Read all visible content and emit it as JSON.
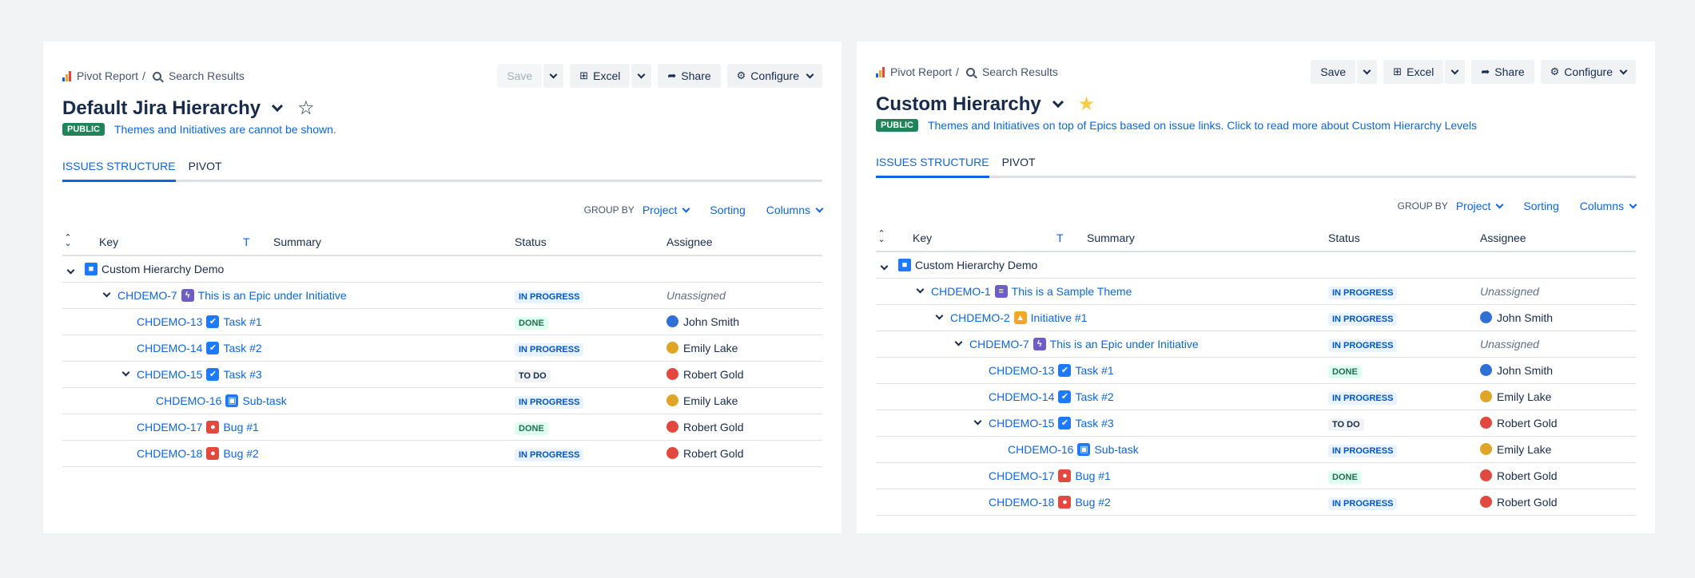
{
  "colors": {
    "accent": "#0c66e4",
    "public": "#1f845a",
    "inprogress": "#0055cc",
    "done": "#216e4e"
  },
  "panels": [
    {
      "breadcrumb": {
        "root": "Pivot Report",
        "separator": "/",
        "current": "Search Results"
      },
      "toolbar": {
        "save": "Save",
        "excel": "Excel",
        "share": "Share",
        "configure": "Configure",
        "save_disabled": true
      },
      "title": "Default Jira Hierarchy",
      "starred": false,
      "lozenge": "PUBLIC",
      "note": "Themes and Initiatives are cannot be shown.",
      "tabs": [
        "ISSUES STRUCTURE",
        "PIVOT"
      ],
      "controls": {
        "group_by_label": "GROUP BY",
        "group_by_value": "Project",
        "sorting": "Sorting",
        "columns": "Columns"
      },
      "headers": {
        "key": "Key",
        "type": "T",
        "summary": "Summary",
        "status": "Status",
        "assignee": "Assignee"
      },
      "rows": [
        {
          "level": 0,
          "expanded": true,
          "type": "project",
          "key": "",
          "summary": "Custom Hierarchy Demo",
          "status": "",
          "status_kind": "",
          "assignee": "",
          "avatar": ""
        },
        {
          "level": 1,
          "expanded": true,
          "type": "epic",
          "key": "CHDEMO-7",
          "summary": "This is an Epic under Initiative",
          "status": "IN PROGRESS",
          "status_kind": "inprogress",
          "assignee": "Unassigned",
          "avatar": ""
        },
        {
          "level": 2,
          "expanded": false,
          "type": "task",
          "key": "CHDEMO-13",
          "summary": "Task #1",
          "status": "DONE",
          "status_kind": "done",
          "assignee": "John Smith",
          "avatar": "#2f6fd6"
        },
        {
          "level": 2,
          "expanded": false,
          "type": "task",
          "key": "CHDEMO-14",
          "summary": "Task #2",
          "status": "IN PROGRESS",
          "status_kind": "inprogress",
          "assignee": "Emily Lake",
          "avatar": "#e0a526"
        },
        {
          "level": 2,
          "expanded": true,
          "type": "task",
          "key": "CHDEMO-15",
          "summary": "Task #3",
          "status": "TO DO",
          "status_kind": "todo",
          "assignee": "Robert Gold",
          "avatar": "#e2483d"
        },
        {
          "level": 3,
          "expanded": false,
          "type": "subtask",
          "key": "CHDEMO-16",
          "summary": "Sub-task",
          "status": "IN PROGRESS",
          "status_kind": "inprogress",
          "assignee": "Emily Lake",
          "avatar": "#e0a526"
        },
        {
          "level": 2,
          "expanded": false,
          "type": "bug",
          "key": "CHDEMO-17",
          "summary": "Bug #1",
          "status": "DONE",
          "status_kind": "done",
          "assignee": "Robert Gold",
          "avatar": "#e2483d"
        },
        {
          "level": 2,
          "expanded": false,
          "type": "bug",
          "key": "CHDEMO-18",
          "summary": "Bug #2",
          "status": "IN PROGRESS",
          "status_kind": "inprogress",
          "assignee": "Robert Gold",
          "avatar": "#e2483d"
        }
      ]
    },
    {
      "breadcrumb": {
        "root": "Pivot Report",
        "separator": "/",
        "current": "Search Results"
      },
      "toolbar": {
        "save": "Save",
        "excel": "Excel",
        "share": "Share",
        "configure": "Configure",
        "save_disabled": false
      },
      "title": "Custom Hierarchy",
      "starred": true,
      "lozenge": "PUBLIC",
      "note": "Themes and Initiatives on top of Epics based on issue links. Click to read more about Custom Hierarchy Levels",
      "tabs": [
        "ISSUES STRUCTURE",
        "PIVOT"
      ],
      "controls": {
        "group_by_label": "GROUP BY",
        "group_by_value": "Project",
        "sorting": "Sorting",
        "columns": "Columns"
      },
      "headers": {
        "key": "Key",
        "type": "T",
        "summary": "Summary",
        "status": "Status",
        "assignee": "Assignee"
      },
      "rows": [
        {
          "level": 0,
          "expanded": true,
          "type": "project",
          "key": "",
          "summary": "Custom Hierarchy Demo",
          "status": "",
          "status_kind": "",
          "assignee": "",
          "avatar": ""
        },
        {
          "level": 1,
          "expanded": true,
          "type": "theme",
          "key": "CHDEMO-1",
          "summary": "This is a Sample Theme",
          "status": "IN PROGRESS",
          "status_kind": "inprogress",
          "assignee": "Unassigned",
          "avatar": ""
        },
        {
          "level": 2,
          "expanded": true,
          "type": "initiative",
          "key": "CHDEMO-2",
          "summary": "Initiative #1",
          "status": "IN PROGRESS",
          "status_kind": "inprogress",
          "assignee": "John Smith",
          "avatar": "#2f6fd6"
        },
        {
          "level": 3,
          "expanded": true,
          "type": "epic",
          "key": "CHDEMO-7",
          "summary": "This is an Epic under Initiative",
          "status": "IN PROGRESS",
          "status_kind": "inprogress",
          "assignee": "Unassigned",
          "avatar": ""
        },
        {
          "level": 4,
          "expanded": false,
          "type": "task",
          "key": "CHDEMO-13",
          "summary": "Task #1",
          "status": "DONE",
          "status_kind": "done",
          "assignee": "John Smith",
          "avatar": "#2f6fd6"
        },
        {
          "level": 4,
          "expanded": false,
          "type": "task",
          "key": "CHDEMO-14",
          "summary": "Task #2",
          "status": "IN PROGRESS",
          "status_kind": "inprogress",
          "assignee": "Emily Lake",
          "avatar": "#e0a526"
        },
        {
          "level": 4,
          "expanded": true,
          "type": "task",
          "key": "CHDEMO-15",
          "summary": "Task #3",
          "status": "TO DO",
          "status_kind": "todo",
          "assignee": "Robert Gold",
          "avatar": "#e2483d"
        },
        {
          "level": 5,
          "expanded": false,
          "type": "subtask",
          "key": "CHDEMO-16",
          "summary": "Sub-task",
          "status": "IN PROGRESS",
          "status_kind": "inprogress",
          "assignee": "Emily Lake",
          "avatar": "#e0a526"
        },
        {
          "level": 4,
          "expanded": false,
          "type": "bug",
          "key": "CHDEMO-17",
          "summary": "Bug #1",
          "status": "DONE",
          "status_kind": "done",
          "assignee": "Robert Gold",
          "avatar": "#e2483d"
        },
        {
          "level": 4,
          "expanded": false,
          "type": "bug",
          "key": "CHDEMO-18",
          "summary": "Bug #2",
          "status": "IN PROGRESS",
          "status_kind": "inprogress",
          "assignee": "Robert Gold",
          "avatar": "#e2483d"
        }
      ]
    }
  ]
}
